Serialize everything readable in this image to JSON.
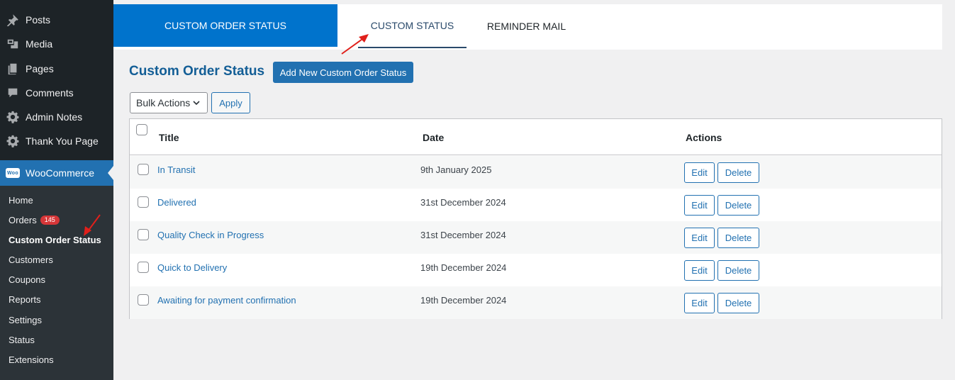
{
  "sidebar": {
    "items": [
      {
        "label": "Posts",
        "icon": "pin-icon"
      },
      {
        "label": "Media",
        "icon": "media-icon"
      },
      {
        "label": "Pages",
        "icon": "pages-icon"
      },
      {
        "label": "Comments",
        "icon": "comments-icon"
      },
      {
        "label": "Admin Notes",
        "icon": "gear-icon"
      },
      {
        "label": "Thank You Page",
        "icon": "gear-icon"
      }
    ],
    "woocommerce": {
      "label": "WooCommerce",
      "logo_text": "Woo"
    },
    "submenu": [
      {
        "label": "Home"
      },
      {
        "label": "Orders",
        "badge": "145"
      },
      {
        "label": "Custom Order Status"
      },
      {
        "label": "Customers"
      },
      {
        "label": "Coupons"
      },
      {
        "label": "Reports"
      },
      {
        "label": "Settings"
      },
      {
        "label": "Status"
      },
      {
        "label": "Extensions"
      }
    ]
  },
  "tabs": {
    "brand": "CUSTOM ORDER STATUS",
    "items": [
      {
        "label": "CUSTOM STATUS",
        "active": true
      },
      {
        "label": "REMINDER MAIL",
        "active": false
      }
    ]
  },
  "header": {
    "title": "Custom Order Status",
    "add_button": "Add New Custom Order Status"
  },
  "toolbar": {
    "bulk_actions": "Bulk Actions",
    "apply": "Apply"
  },
  "table": {
    "columns": [
      "Title",
      "Date",
      "Actions"
    ],
    "rows": [
      {
        "title": "In Transit",
        "date": "9th January 2025"
      },
      {
        "title": "Delivered",
        "date": "31st December 2024"
      },
      {
        "title": "Quality Check in Progress",
        "date": "31st December 2024"
      },
      {
        "title": "Quick to Delivery",
        "date": "19th December 2024"
      },
      {
        "title": "Awaiting for payment confirmation",
        "date": "19th December 2024"
      }
    ],
    "edit_label": "Edit",
    "delete_label": "Delete"
  },
  "colors": {
    "sidebar_bg": "#1d2327",
    "accent": "#2271b1",
    "brand_tab": "#0073cc",
    "badge": "#d63638",
    "annotation_arrow": "#e0201b"
  }
}
